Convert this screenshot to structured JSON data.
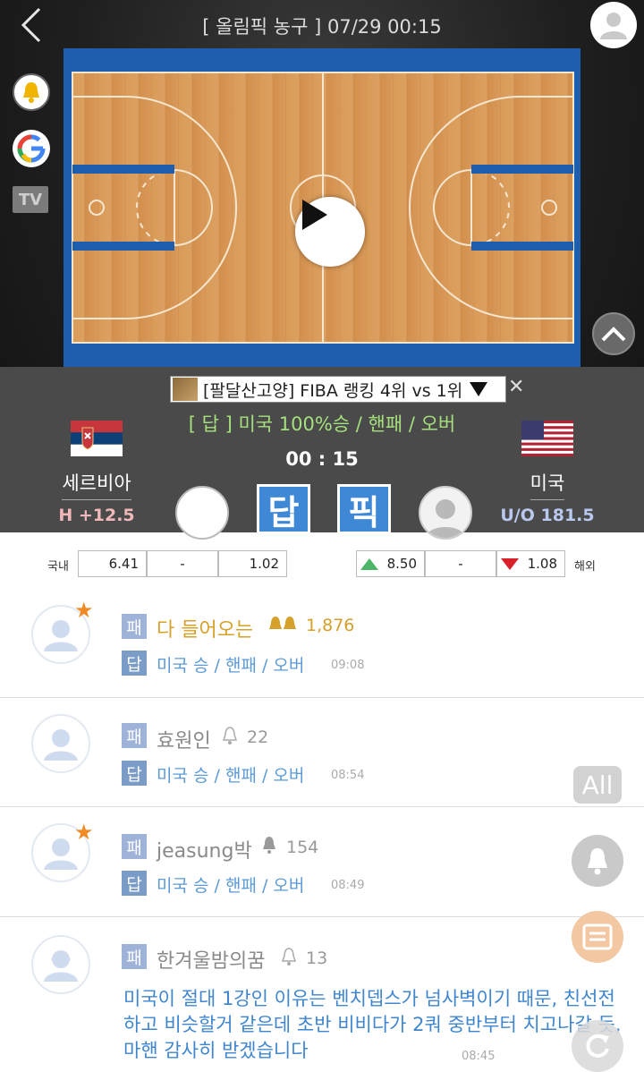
{
  "header": {
    "title": "[ 올림픽 농구 ]  07/29  00:15"
  },
  "side_icons": [
    "bell-icon",
    "google-icon",
    "tv-icon"
  ],
  "tv_label": "TV",
  "video": {
    "play_icon": "play-icon",
    "collapse_icon": "chevron-up-icon"
  },
  "match": {
    "banner": "[팔달산고양] FIBA 랭킹 4위 vs 1위",
    "answer_line": "[ 답 ]  미국  100%승 / 핸패 / 오버",
    "time": "00 : 15",
    "home": {
      "name": "세르비아",
      "line": "H +12.5"
    },
    "away": {
      "name": "미국",
      "line": "U/O 181.5"
    },
    "dab_label": "답",
    "pick_label": "픽"
  },
  "odds": {
    "domestic_label": "국내",
    "domestic": [
      "6.41",
      "-",
      "1.02"
    ],
    "overseas_label": "해외",
    "overseas": [
      "8.50",
      "-",
      "1.08"
    ]
  },
  "comments": [
    {
      "tag": "패",
      "nick": "다 들어오는",
      "count": "1,876",
      "answer_tag": "답",
      "pick": "미국 승 / 핸패 / 오버",
      "time": "09:08"
    },
    {
      "tag": "패",
      "nick": "효원인",
      "count": "22",
      "answer_tag": "답",
      "pick": "미국 승 / 핸패 / 오버",
      "time": "08:54"
    },
    {
      "tag": "패",
      "nick": "jeasung박",
      "count": "154",
      "answer_tag": "답",
      "pick": "미국 승 / 핸패 / 오버",
      "time": "08:49"
    },
    {
      "tag": "패",
      "nick": "한겨울밤의꿈",
      "count": "13",
      "text": "미국이 절대 1강인 이유는 벤치뎁스가 넘사벽이기 때문, 친선전하고 비슷할거 같은데 초반 비비다가 2쿼 중반부터 치고나갈 듯, 마핸 감사히 받겠습니다",
      "time": "08:45"
    }
  ],
  "fab": {
    "all_label": "All"
  },
  "colors": {
    "accent_blue": "#3f88d6",
    "green_line": "#a5e07d",
    "gold": "#d6a12a",
    "orange_star": "#f08a24"
  }
}
